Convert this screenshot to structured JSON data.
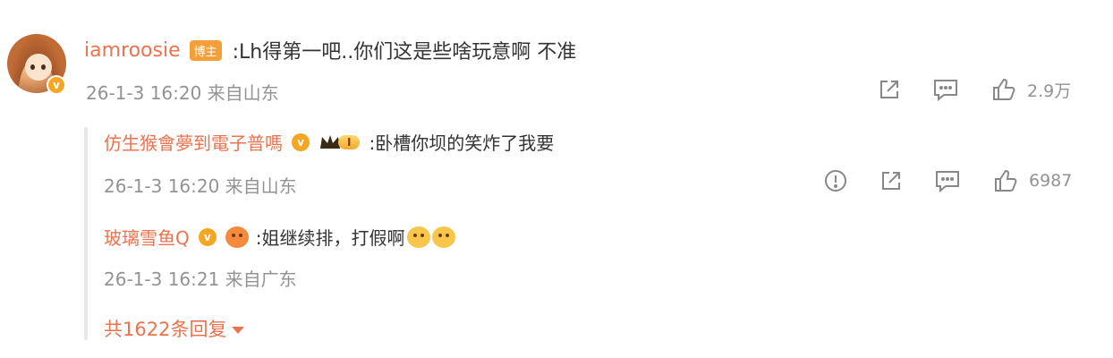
{
  "comment": {
    "username": "iamroosie",
    "author_tag": "博主",
    "text": ":Lh得第一吧..你们这是些啥玩意啊 不准",
    "meta": "26-1-3 16:20 来自山东",
    "like_count": "2.9万"
  },
  "replies": [
    {
      "username": "仿生猴會夢到電子普嗎",
      "level_badge": "I",
      "text": ":卧槽你坝的笑炸了我要",
      "meta": "26-1-3 16:20 来自山东",
      "like_count": "6987"
    },
    {
      "username": "玻璃雪鱼Q",
      "text": ":姐继续排，打假啊",
      "meta": "26-1-3 16:21 来自广东"
    }
  ],
  "more_replies_label": "共1622条回复",
  "colors": {
    "username": "#eb7350",
    "meta": "#939393",
    "author_tag": "#f3a03a"
  },
  "icons": [
    "share-icon",
    "comment-icon",
    "like-icon",
    "report-icon",
    "chevron-down-icon"
  ]
}
